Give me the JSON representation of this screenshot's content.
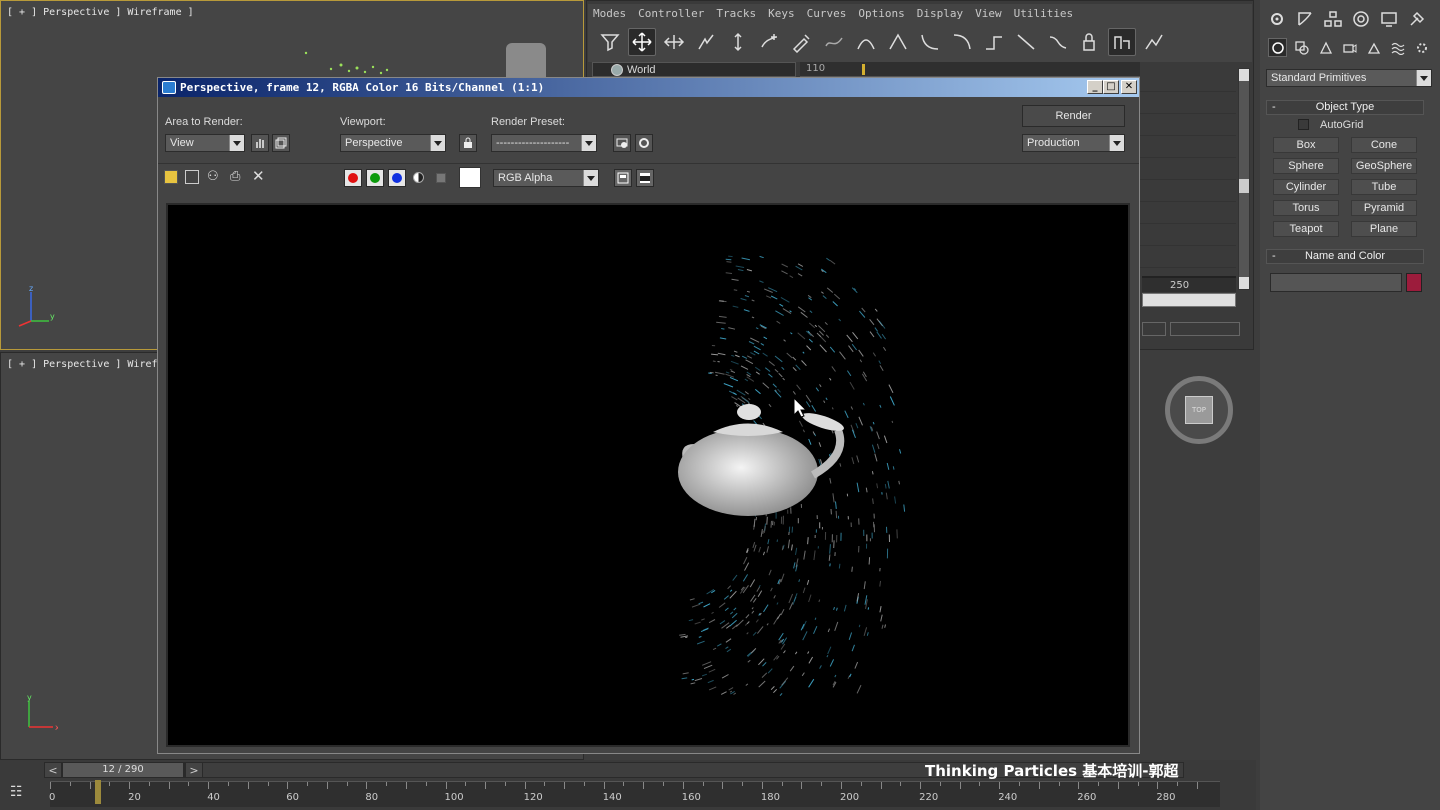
{
  "viewports": {
    "top_left_label": "[ + ] Perspective ] Wireframe ]",
    "bottom_left_label": "[ + ] Perspective ] Wirefra"
  },
  "menubar": [
    "Modes",
    "Controller",
    "Tracks",
    "Keys",
    "Curves",
    "Options",
    "Display",
    "View",
    "Utilities"
  ],
  "track_view": {
    "world_label": "World",
    "ruler_start": "110",
    "ruler_end": "250"
  },
  "render_window": {
    "title": "Perspective, frame 12, RGBA Color 16 Bits/Channel (1:1)",
    "area_label": "Area to Render:",
    "area_value": "View",
    "viewport_label": "Viewport:",
    "viewport_value": "Perspective",
    "preset_label": "Render Preset:",
    "preset_value": "--------------------",
    "render_button": "Render",
    "production_value": "Production",
    "channel_value": "RGB Alpha",
    "channel_colors": {
      "red": "#e01010",
      "green": "#0c9a0c",
      "blue": "#1030e0"
    }
  },
  "command_panel": {
    "category": "Standard Primitives",
    "object_type_title": "Object Type",
    "autogrid_label": "AutoGrid",
    "primitives": [
      "Box",
      "Cone",
      "Sphere",
      "GeoSphere",
      "Cylinder",
      "Tube",
      "Torus",
      "Pyramid",
      "Teapot",
      "Plane"
    ],
    "name_color_title": "Name and Color",
    "object_color": "#9c1c3c",
    "viewcube_label": "TOP"
  },
  "timeline": {
    "frame_display": "12 / 290",
    "prev": "<",
    "next": ">",
    "ticks": [
      "0",
      "20",
      "40",
      "60",
      "80",
      "100",
      "120",
      "140",
      "160",
      "180",
      "200",
      "220",
      "240",
      "260",
      "280"
    ]
  },
  "caption": "Thinking Particles 基本培训-郭超"
}
